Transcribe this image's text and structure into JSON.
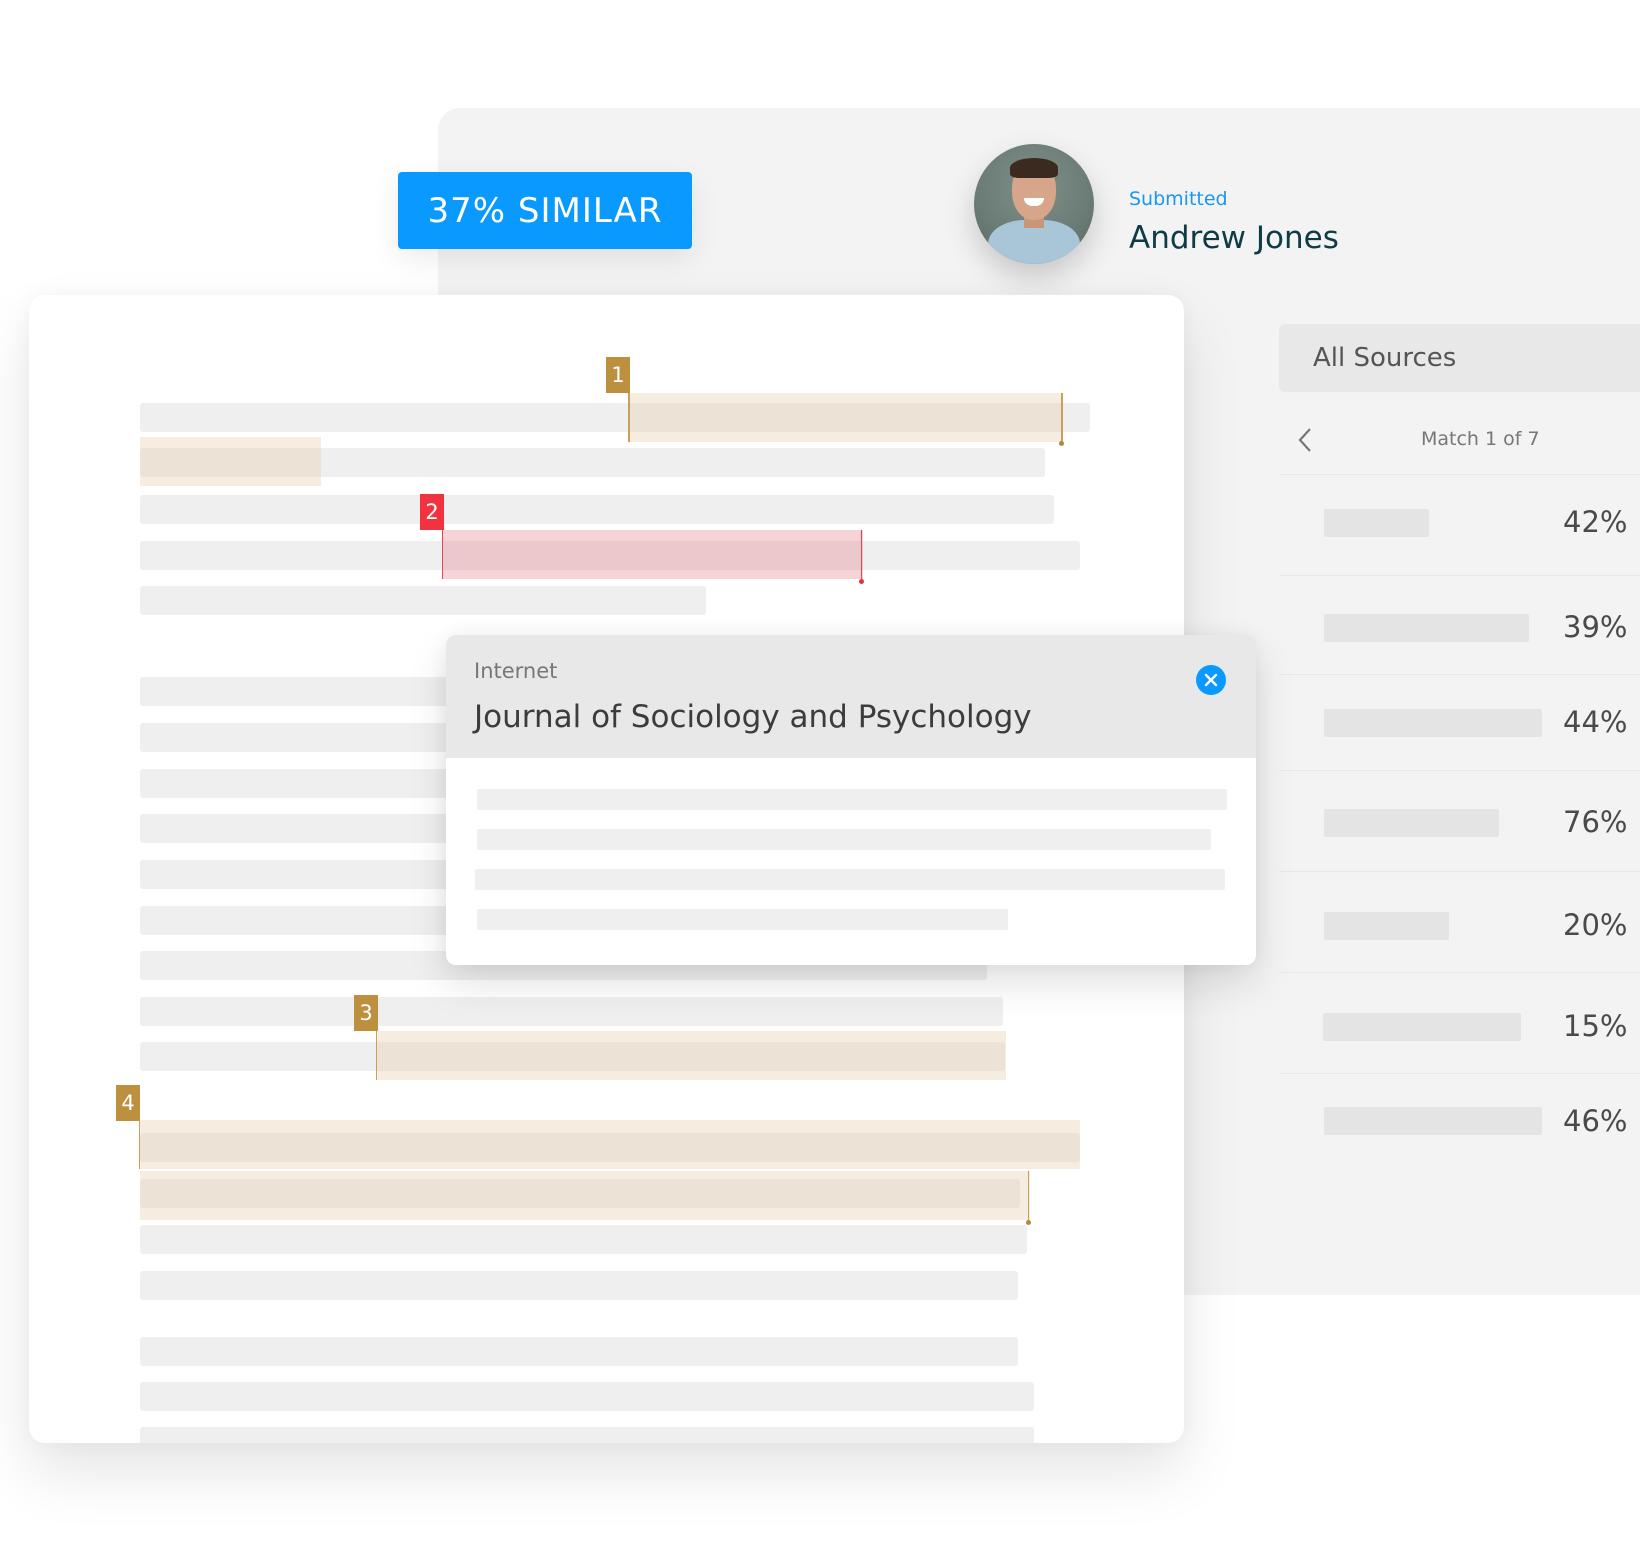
{
  "similarity": {
    "label": "37% SIMILAR",
    "percent": 37,
    "color": "#0a99ff"
  },
  "submission": {
    "status_label": "Submitted",
    "submitter_name": "Andrew Jones",
    "avatar_icon": "user-photo"
  },
  "sources_panel": {
    "header_label": "All Sources",
    "match_nav": {
      "prev_icon": "chevron-left-icon",
      "label": "Match 1 of 7",
      "current": 1,
      "total": 7
    },
    "sources": [
      {
        "percent_label": "42%",
        "percent": 42
      },
      {
        "percent_label": "39%",
        "percent": 39
      },
      {
        "percent_label": "44%",
        "percent": 44
      },
      {
        "percent_label": "76%",
        "percent": 76
      },
      {
        "percent_label": "20%",
        "percent": 20
      },
      {
        "percent_label": "15%",
        "percent": 15
      },
      {
        "percent_label": "46%",
        "percent": 46
      }
    ]
  },
  "document": {
    "match_markers": [
      {
        "label": "1",
        "color": "#bd9040"
      },
      {
        "label": "2",
        "color": "#f2323f"
      },
      {
        "label": "3",
        "color": "#bd9040"
      },
      {
        "label": "4",
        "color": "#bd9040"
      }
    ]
  },
  "source_popup": {
    "type_label": "Internet",
    "title": "Journal of Sociology and Psychology",
    "close_icon": "close-icon"
  }
}
